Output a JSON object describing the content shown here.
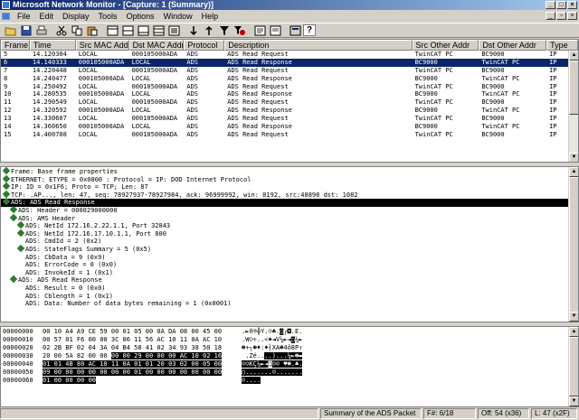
{
  "window": {
    "title": "Microsoft Network Monitor - [Capture: 1 (Summary)]"
  },
  "menu": [
    "File",
    "Edit",
    "Display",
    "Tools",
    "Options",
    "Window",
    "Help"
  ],
  "toolbar_icons": [
    "open-icon",
    "save-icon",
    "print-icon",
    "cut-icon",
    "copy-icon",
    "paste-icon",
    "pane-summary-icon",
    "pane-detail-icon",
    "pane-hex-icon",
    "pane-all-icon",
    "zoom-icon",
    "next-icon",
    "previous-icon",
    "filter-icon",
    "display-filter-icon",
    "find-icon",
    "find-previous-icon",
    "properties-icon",
    "help-icon"
  ],
  "summary": {
    "columns": [
      "Frame",
      "Time",
      "Src MAC Addr",
      "Dst MAC Addr",
      "Protocol",
      "Description",
      "Src Other Addr",
      "Dst Other Addr",
      "Type"
    ],
    "rows": [
      [
        "5",
        "14.120304",
        "LOCAL",
        "000105000ADA",
        "ADS",
        "ADS Read Request",
        "TwinCAT PC",
        "BC9000",
        "IP"
      ],
      [
        "6",
        "14.140333",
        "000105000ADA",
        "LOCAL",
        "ADS",
        "ADS Read Response",
        "BC9000",
        "TwinCAT PC",
        "IP"
      ],
      [
        "7",
        "14.220448",
        "LOCAL",
        "000105000ADA",
        "ADS",
        "ADS Read Request",
        "TwinCAT PC",
        "BC9000",
        "IP"
      ],
      [
        "8",
        "14.240477",
        "000105000ADA",
        "LOCAL",
        "ADS",
        "ADS Read Response",
        "BC9000",
        "TwinCAT PC",
        "IP"
      ],
      [
        "9",
        "14.250492",
        "LOCAL",
        "000105000ADA",
        "ADS",
        "ADS Read Request",
        "TwinCAT PC",
        "BC9000",
        "IP"
      ],
      [
        "10",
        "14.280535",
        "000105000ADA",
        "LOCAL",
        "ADS",
        "ADS Read Response",
        "BC9000",
        "TwinCAT PC",
        "IP"
      ],
      [
        "11",
        "14.290549",
        "LOCAL",
        "000105000ADA",
        "ADS",
        "ADS Read Request",
        "TwinCAT PC",
        "BC9000",
        "IP"
      ],
      [
        "12",
        "14.320592",
        "000105000ADA",
        "LOCAL",
        "ADS",
        "ADS Read Response",
        "BC9000",
        "TwinCAT PC",
        "IP"
      ],
      [
        "13",
        "14.330607",
        "LOCAL",
        "000105000ADA",
        "ADS",
        "ADS Read Request",
        "TwinCAT PC",
        "BC9000",
        "IP"
      ],
      [
        "14",
        "14.360650",
        "000105000ADA",
        "LOCAL",
        "ADS",
        "ADS Read Response",
        "BC9000",
        "TwinCAT PC",
        "IP"
      ],
      [
        "15",
        "14.400708",
        "LOCAL",
        "000105000ADA",
        "ADS",
        "ADS Read Request",
        "TwinCAT PC",
        "BC9000",
        "IP"
      ]
    ],
    "selected_index": 1
  },
  "detail": {
    "lines": [
      {
        "indent": 0,
        "icon": true,
        "text": "Frame: Base frame properties"
      },
      {
        "indent": 0,
        "icon": true,
        "text": "ETHERNET: ETYPE = 0x0800 : Protocol = IP:  DOD Internet Protocol"
      },
      {
        "indent": 0,
        "icon": true,
        "text": "IP: ID = 0x1F6; Proto = TCP; Len: 87"
      },
      {
        "indent": 0,
        "icon": true,
        "text": "TCP: .AP..., len:   47, seq:  78927937-78927984, ack:  96999992, win: 8192, src:48898  dst: 1082"
      },
      {
        "indent": 0,
        "icon": true,
        "text": "ADS: ADS Read Response",
        "selected": true
      },
      {
        "indent": 1,
        "icon": true,
        "text": "ADS: Header = 000029000000"
      },
      {
        "indent": 1,
        "icon": true,
        "text": "ADS: AMS Header"
      },
      {
        "indent": 2,
        "icon": true,
        "text": "ADS: NetId 172.16.2.22.1.1, Port 32843"
      },
      {
        "indent": 2,
        "icon": true,
        "text": "ADS: NetId 172.16.17.10.1.1, Port 800"
      },
      {
        "indent": 2,
        "icon": false,
        "text": "ADS: CmdId = 2 (0x2)"
      },
      {
        "indent": 2,
        "icon": true,
        "text": "ADS: StateFlags Summary = 5 (0x5)"
      },
      {
        "indent": 2,
        "icon": false,
        "text": "ADS: CbData = 9 (0x9)"
      },
      {
        "indent": 2,
        "icon": false,
        "text": "ADS: ErrorCode = 0 (0x0)"
      },
      {
        "indent": 2,
        "icon": false,
        "text": "ADS: InvokeId = 1 (0x1)"
      },
      {
        "indent": 1,
        "icon": true,
        "text": "ADS: ADS Read Response"
      },
      {
        "indent": 2,
        "icon": false,
        "text": "ADS: Result = 0 (0x0)"
      },
      {
        "indent": 2,
        "icon": false,
        "text": "ADS: Cblength = 1 (0x1)"
      },
      {
        "indent": 2,
        "icon": false,
        "text": "ADS: Data: Number of data bytes remaining = 1 (0x0001)"
      }
    ]
  },
  "hex": {
    "lines": [
      {
        "off": "00000000",
        "pre": "00 10 A4 A9 CE 59 00 01 05 00 0A DA 08 00 45 00",
        "sel": "",
        "ascii_pre": ".►ñ®╬Y.☺♣.◙┌◘.E.",
        "ascii_sel": ""
      },
      {
        "off": "00000010",
        "pre": "00 57 01 F6 00 00 3C 06 11 56 AC 10 11 0A AC 10",
        "sel": "",
        "ascii_pre": ".W☺÷..<♠◄V¼►◄◙¼►",
        "ascii_sel": ""
      },
      {
        "off": "00000020",
        "pre": "02 2B BF 02 04 3A 04 B4 58 41 02 34 93 38 50 18",
        "sel": "",
        "ascii_pre": "☻+┐☻♦:♦┤XA☻4ô8P↑",
        "ascii_sel": ""
      },
      {
        "off": "00000030",
        "pre": "20 00 5A 82 00 00 ",
        "sel": "00 00 29 00 00 00 AC 10 02 16",
        "ascii_pre": " .Zé..",
        "ascii_sel": "..)...¼►☻▬"
      },
      {
        "off": "00000040",
        "pre": "",
        "sel": "01 01 4B 80 AC 10 11 0A 01 01 20 03 02 00 05 00",
        "ascii_pre": "",
        "ascii_sel": "☺☺KÇ¼►◄◙☺☺ ♥☻.♣."
      },
      {
        "off": "00000050",
        "pre": "",
        "sel": "09 00 00 00 00 00 00 00 01 00 00 00 00 00 00 00",
        "ascii_pre": "",
        "ascii_sel": "○.......☺......."
      },
      {
        "off": "00000060",
        "pre": "",
        "sel": "01 00 00 00 00",
        "ascii_pre": "",
        "ascii_sel": "☺...."
      }
    ]
  },
  "status": {
    "summary": "Summary of the ADS Packet",
    "frame": "F#: 6/18",
    "offset": "Off: 54 (x36)",
    "length": "L: 47 (x2F)"
  }
}
